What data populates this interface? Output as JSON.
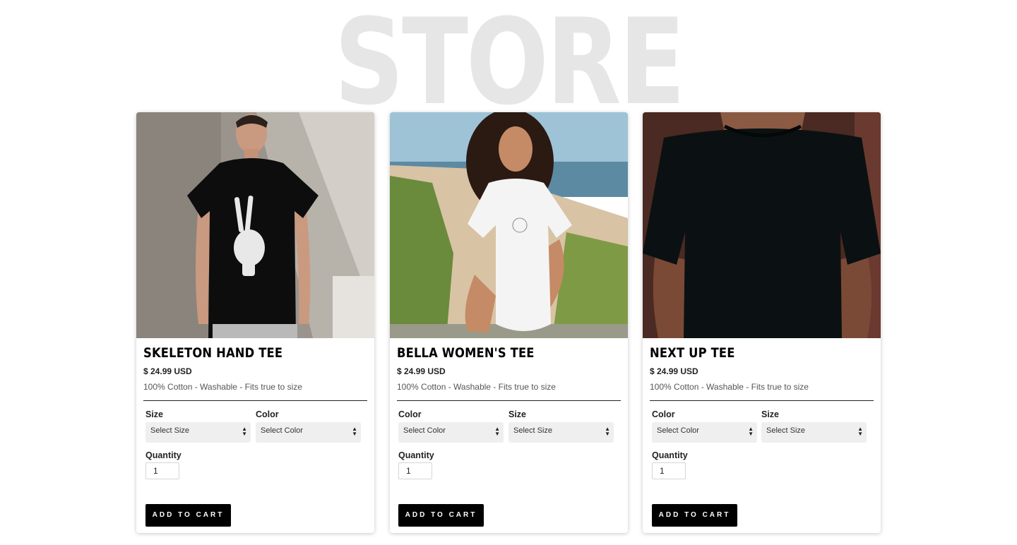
{
  "page": {
    "heading": "STORE"
  },
  "products": [
    {
      "name": "SKELETON HAND TEE",
      "price": "$ 24.99 USD",
      "description": "100% Cotton - Washable - Fits true to size",
      "option1": {
        "label": "Size",
        "value": "Select Size"
      },
      "option2": {
        "label": "Color",
        "value": "Select Color"
      },
      "quantity_label": "Quantity",
      "quantity": "1",
      "button": "ADD TO CART"
    },
    {
      "name": "BELLA WOMEN'S TEE",
      "price": "$ 24.99 USD",
      "description": "100% Cotton - Washable - Fits true to size",
      "option1": {
        "label": "Color",
        "value": "Select Color"
      },
      "option2": {
        "label": "Size",
        "value": "Select Size"
      },
      "quantity_label": "Quantity",
      "quantity": "1",
      "button": "ADD TO CART"
    },
    {
      "name": "NEXT UP TEE",
      "price": "$ 24.99 USD",
      "description": "100% Cotton - Washable - Fits true to size",
      "option1": {
        "label": "Color",
        "value": "Select Color"
      },
      "option2": {
        "label": "Size",
        "value": "Select Size"
      },
      "quantity_label": "Quantity",
      "quantity": "1",
      "button": "ADD TO CART"
    }
  ],
  "colors": {
    "button_bg": "#000000",
    "select_bg": "#efefef",
    "heading_watermark": "#e6e6e6"
  }
}
